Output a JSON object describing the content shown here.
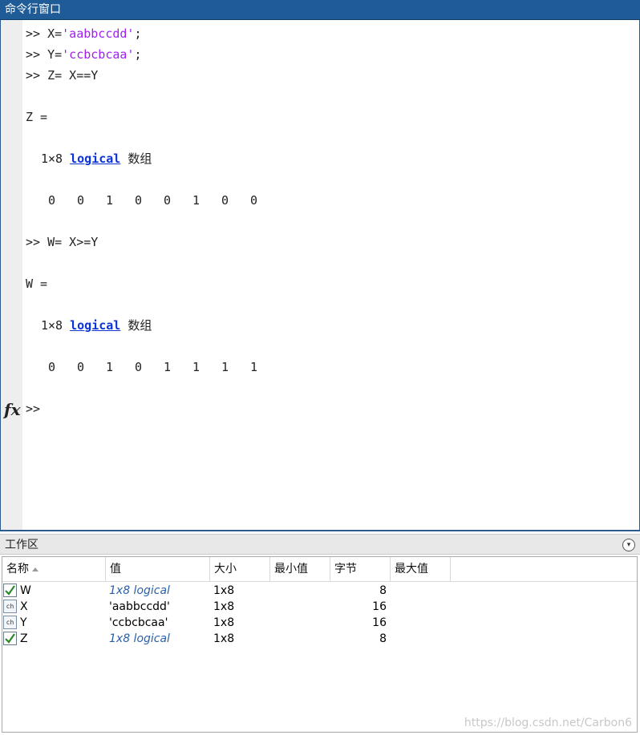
{
  "command_window": {
    "title": "命令行窗口",
    "lines": {
      "l1_prefix": ">> X=",
      "l1_str": "'aabbccdd'",
      "l1_suffix": ";",
      "l2_prefix": ">> Y=",
      "l2_str": "'ccbcbcaa'",
      "l2_suffix": ";",
      "l3": ">> Z= X==Y",
      "l4": "Z =",
      "l5_size": "1×8",
      "l5_link": "logical",
      "l5_suffix": "数组",
      "z_values": [
        "0",
        "0",
        "1",
        "0",
        "0",
        "1",
        "0",
        "0"
      ],
      "l7": ">> W= X>=Y",
      "l8": "W =",
      "l9_size": "1×8",
      "l9_link": "logical",
      "l9_suffix": "数组",
      "w_values": [
        "0",
        "0",
        "1",
        "0",
        "1",
        "1",
        "1",
        "1"
      ],
      "prompt": ">>"
    },
    "fx_label": "fx"
  },
  "workspace": {
    "title": "工作区",
    "menu_icon": "▾",
    "columns": [
      "名称",
      "值",
      "大小",
      "最小值",
      "字节",
      "最大值"
    ],
    "rows": [
      {
        "icon": "logical-check-icon",
        "name": "W",
        "value": "1x8 logical",
        "size": "1x8",
        "bytes": "8"
      },
      {
        "icon": "char-array-icon",
        "name": "X",
        "value": "'aabbccdd'",
        "size": "1x8",
        "bytes": "16"
      },
      {
        "icon": "char-array-icon",
        "name": "Y",
        "value": "'ccbcbcaa'",
        "size": "1x8",
        "bytes": "16"
      },
      {
        "icon": "logical-check-icon",
        "name": "Z",
        "value": "1x8 logical",
        "size": "1x8",
        "bytes": "8"
      }
    ],
    "char_icon_text": "ch"
  },
  "watermark": "https://blog.csdn.net/Carbon6",
  "colors": {
    "title_bar": "#1f5b96",
    "string_literal": "#a020f0",
    "link": "#0b33d6",
    "logical_value": "#2a5fa8"
  }
}
